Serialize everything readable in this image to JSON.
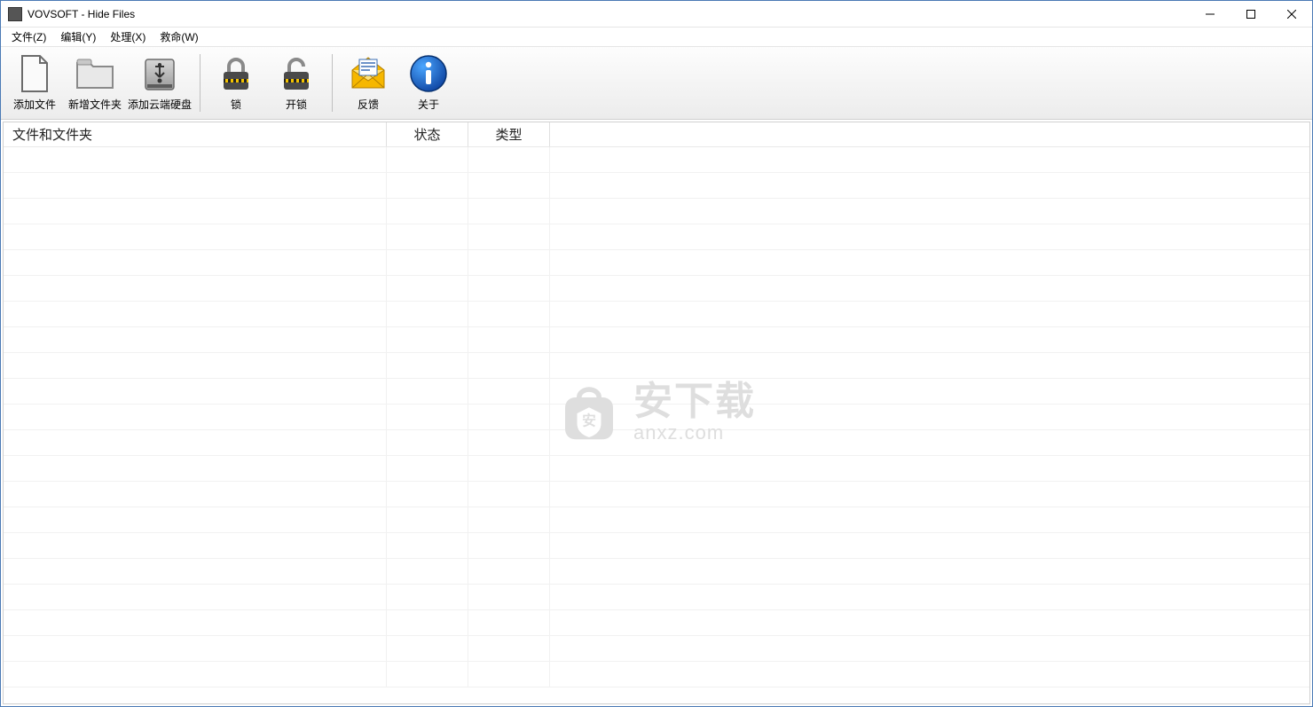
{
  "window": {
    "title": "VOVSOFT - Hide Files"
  },
  "menu": {
    "items": [
      {
        "label": "文件(Z)"
      },
      {
        "label": "编辑(Y)"
      },
      {
        "label": "处理(X)"
      },
      {
        "label": "救命(W)"
      }
    ]
  },
  "toolbar": {
    "add_file": "添加文件",
    "add_folder": "新增文件夹",
    "add_cloud": "添加云端硬盘",
    "lock": "锁",
    "unlock": "开锁",
    "feedback": "反馈",
    "about": "关于"
  },
  "grid": {
    "columns": [
      "文件和文件夹",
      "状态",
      "类型"
    ]
  },
  "watermark": {
    "main": "安下载",
    "sub": "anxz.com"
  }
}
